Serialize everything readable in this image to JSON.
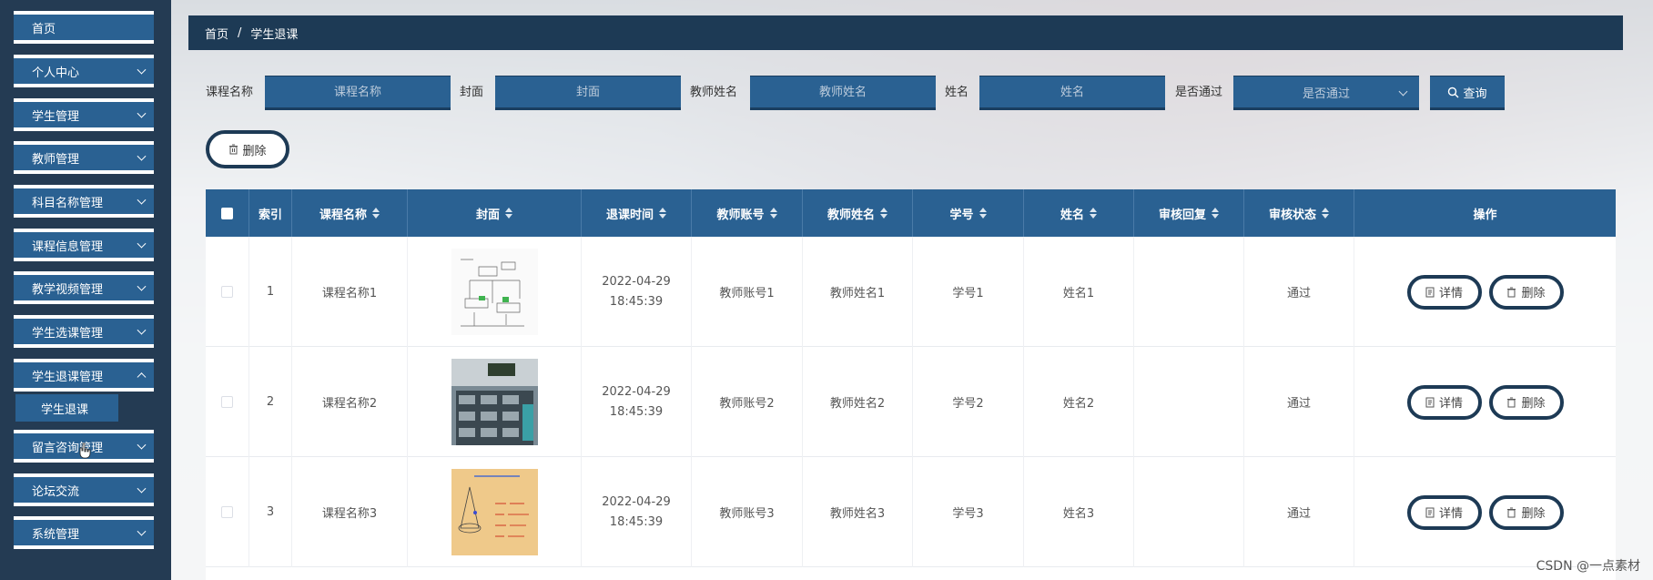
{
  "sidebar": {
    "items": [
      {
        "label": "首页",
        "has_arrow": false
      },
      {
        "label": "个人中心",
        "has_arrow": true
      },
      {
        "label": "学生管理",
        "has_arrow": true
      },
      {
        "label": "教师管理",
        "has_arrow": true
      },
      {
        "label": "科目名称管理",
        "has_arrow": true
      },
      {
        "label": "课程信息管理",
        "has_arrow": true
      },
      {
        "label": "教学视频管理",
        "has_arrow": true
      },
      {
        "label": "学生选课管理",
        "has_arrow": true
      },
      {
        "label": "学生退课管理",
        "has_arrow": true
      },
      {
        "label": "留言咨询管理",
        "has_arrow": true
      },
      {
        "label": "论坛交流",
        "has_arrow": true
      },
      {
        "label": "系统管理",
        "has_arrow": true
      }
    ],
    "submenu_active": "学生退课"
  },
  "breadcrumb": {
    "home": "首页",
    "separator": "/",
    "current": "学生退课"
  },
  "search": {
    "course_label": "课程名称",
    "course_placeholder": "课程名称",
    "cover_label": "封面",
    "cover_placeholder": "封面",
    "teacher_label": "教师姓名",
    "teacher_placeholder": "教师姓名",
    "name_label": "姓名",
    "name_placeholder": "姓名",
    "pass_label": "是否通过",
    "pass_placeholder": "是否通过",
    "query_label": "查询"
  },
  "toolbar": {
    "delete_label": "删除"
  },
  "table": {
    "headers": {
      "index": "索引",
      "course": "课程名称",
      "cover": "封面",
      "time": "退课时间",
      "teacher_account": "教师账号",
      "teacher_name": "教师姓名",
      "student_no": "学号",
      "name": "姓名",
      "reply": "审核回复",
      "status": "审核状态",
      "ops": "操作"
    },
    "rows": [
      {
        "index": "1",
        "course": "课程名称1",
        "time": "2022-04-29 18:45:39",
        "teacher_account": "教师账号1",
        "teacher_name": "教师姓名1",
        "student_no": "学号1",
        "name": "姓名1",
        "reply": "",
        "status": "通过"
      },
      {
        "index": "2",
        "course": "课程名称2",
        "time": "2022-04-29 18:45:39",
        "teacher_account": "教师账号2",
        "teacher_name": "教师姓名2",
        "student_no": "学号2",
        "name": "姓名2",
        "reply": "",
        "status": "通过"
      },
      {
        "index": "3",
        "course": "课程名称3",
        "time": "2022-04-29 18:45:39",
        "teacher_account": "教师账号3",
        "teacher_name": "教师姓名3",
        "student_no": "学号3",
        "name": "姓名3",
        "reply": "",
        "status": "通过"
      }
    ],
    "detail_label": "详情",
    "delete_label": "删除"
  },
  "watermark": "CSDN @一点素材",
  "colors": {
    "sidebar": "#243b53",
    "accent": "#2a6192",
    "dark": "#1d3a55"
  }
}
